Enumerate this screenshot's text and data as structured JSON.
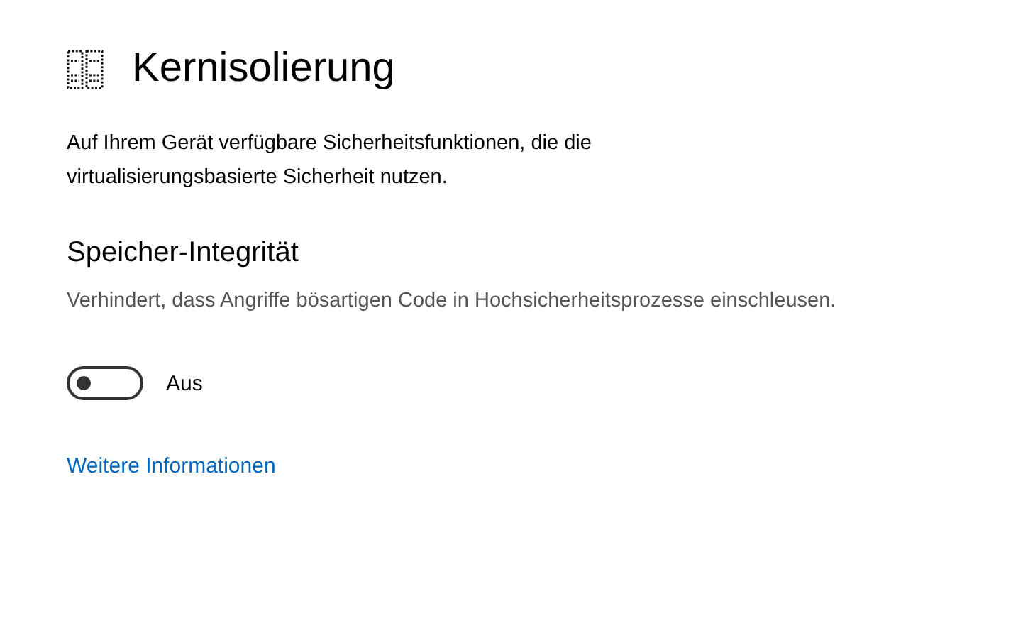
{
  "title": "Kernisolierung",
  "description": "Auf Ihrem Gerät verfügbare Sicherheitsfunktionen, die die virtualisierungsbasierte Sicherheit nutzen.",
  "section": {
    "title": "Speicher-Integrität",
    "description": "Verhindert, dass Angriffe bösartigen Code in Hochsicherheitsprozesse einschleusen.",
    "toggle": {
      "on": false,
      "label": "Aus"
    }
  },
  "link": "Weitere Informationen"
}
